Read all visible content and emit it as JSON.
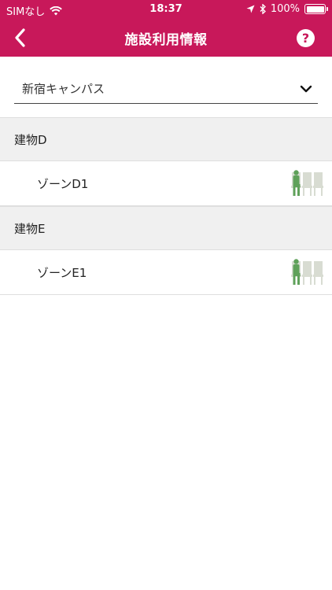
{
  "status_bar": {
    "carrier": "SIMなし",
    "time": "18:37",
    "battery_percent_label": "100%",
    "battery_level": 1.0
  },
  "nav": {
    "title": "施設利用情報",
    "back_icon": "chevron-left-icon",
    "help_label": "?"
  },
  "campus_picker": {
    "selected": "新宿キャンパス"
  },
  "buildings": [
    {
      "name": "建物D",
      "zones": [
        {
          "name": "ゾーンD1",
          "occupancy_icon": "seat-occupancy-icon"
        }
      ]
    },
    {
      "name": "建物E",
      "zones": [
        {
          "name": "ゾーンE1",
          "occupancy_icon": "seat-occupancy-icon"
        }
      ]
    }
  ],
  "colors": {
    "accent": "#c8185a",
    "occupied": "#5fa15a",
    "vacant": "#d8dcd2"
  }
}
